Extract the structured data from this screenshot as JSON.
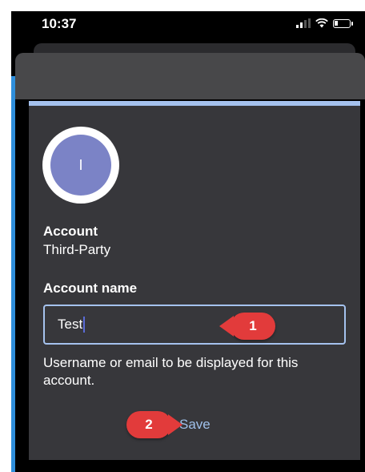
{
  "status_bar": {
    "time": "10:37",
    "icons": [
      "signal-icon",
      "wifi-icon",
      "battery-icon"
    ]
  },
  "avatar": {
    "initial": "I"
  },
  "account": {
    "label": "Account",
    "type": "Third-Party"
  },
  "account_name": {
    "label": "Account name",
    "value": "Test",
    "helper": "Username or email to be displayed for this account."
  },
  "actions": {
    "save_label": "Save"
  },
  "callouts": [
    "1",
    "2"
  ],
  "colors": {
    "accent": "#a5c2ee",
    "callout": "#e23b3b",
    "avatar": "#7b83c6",
    "save_link": "#9fc0ea"
  }
}
